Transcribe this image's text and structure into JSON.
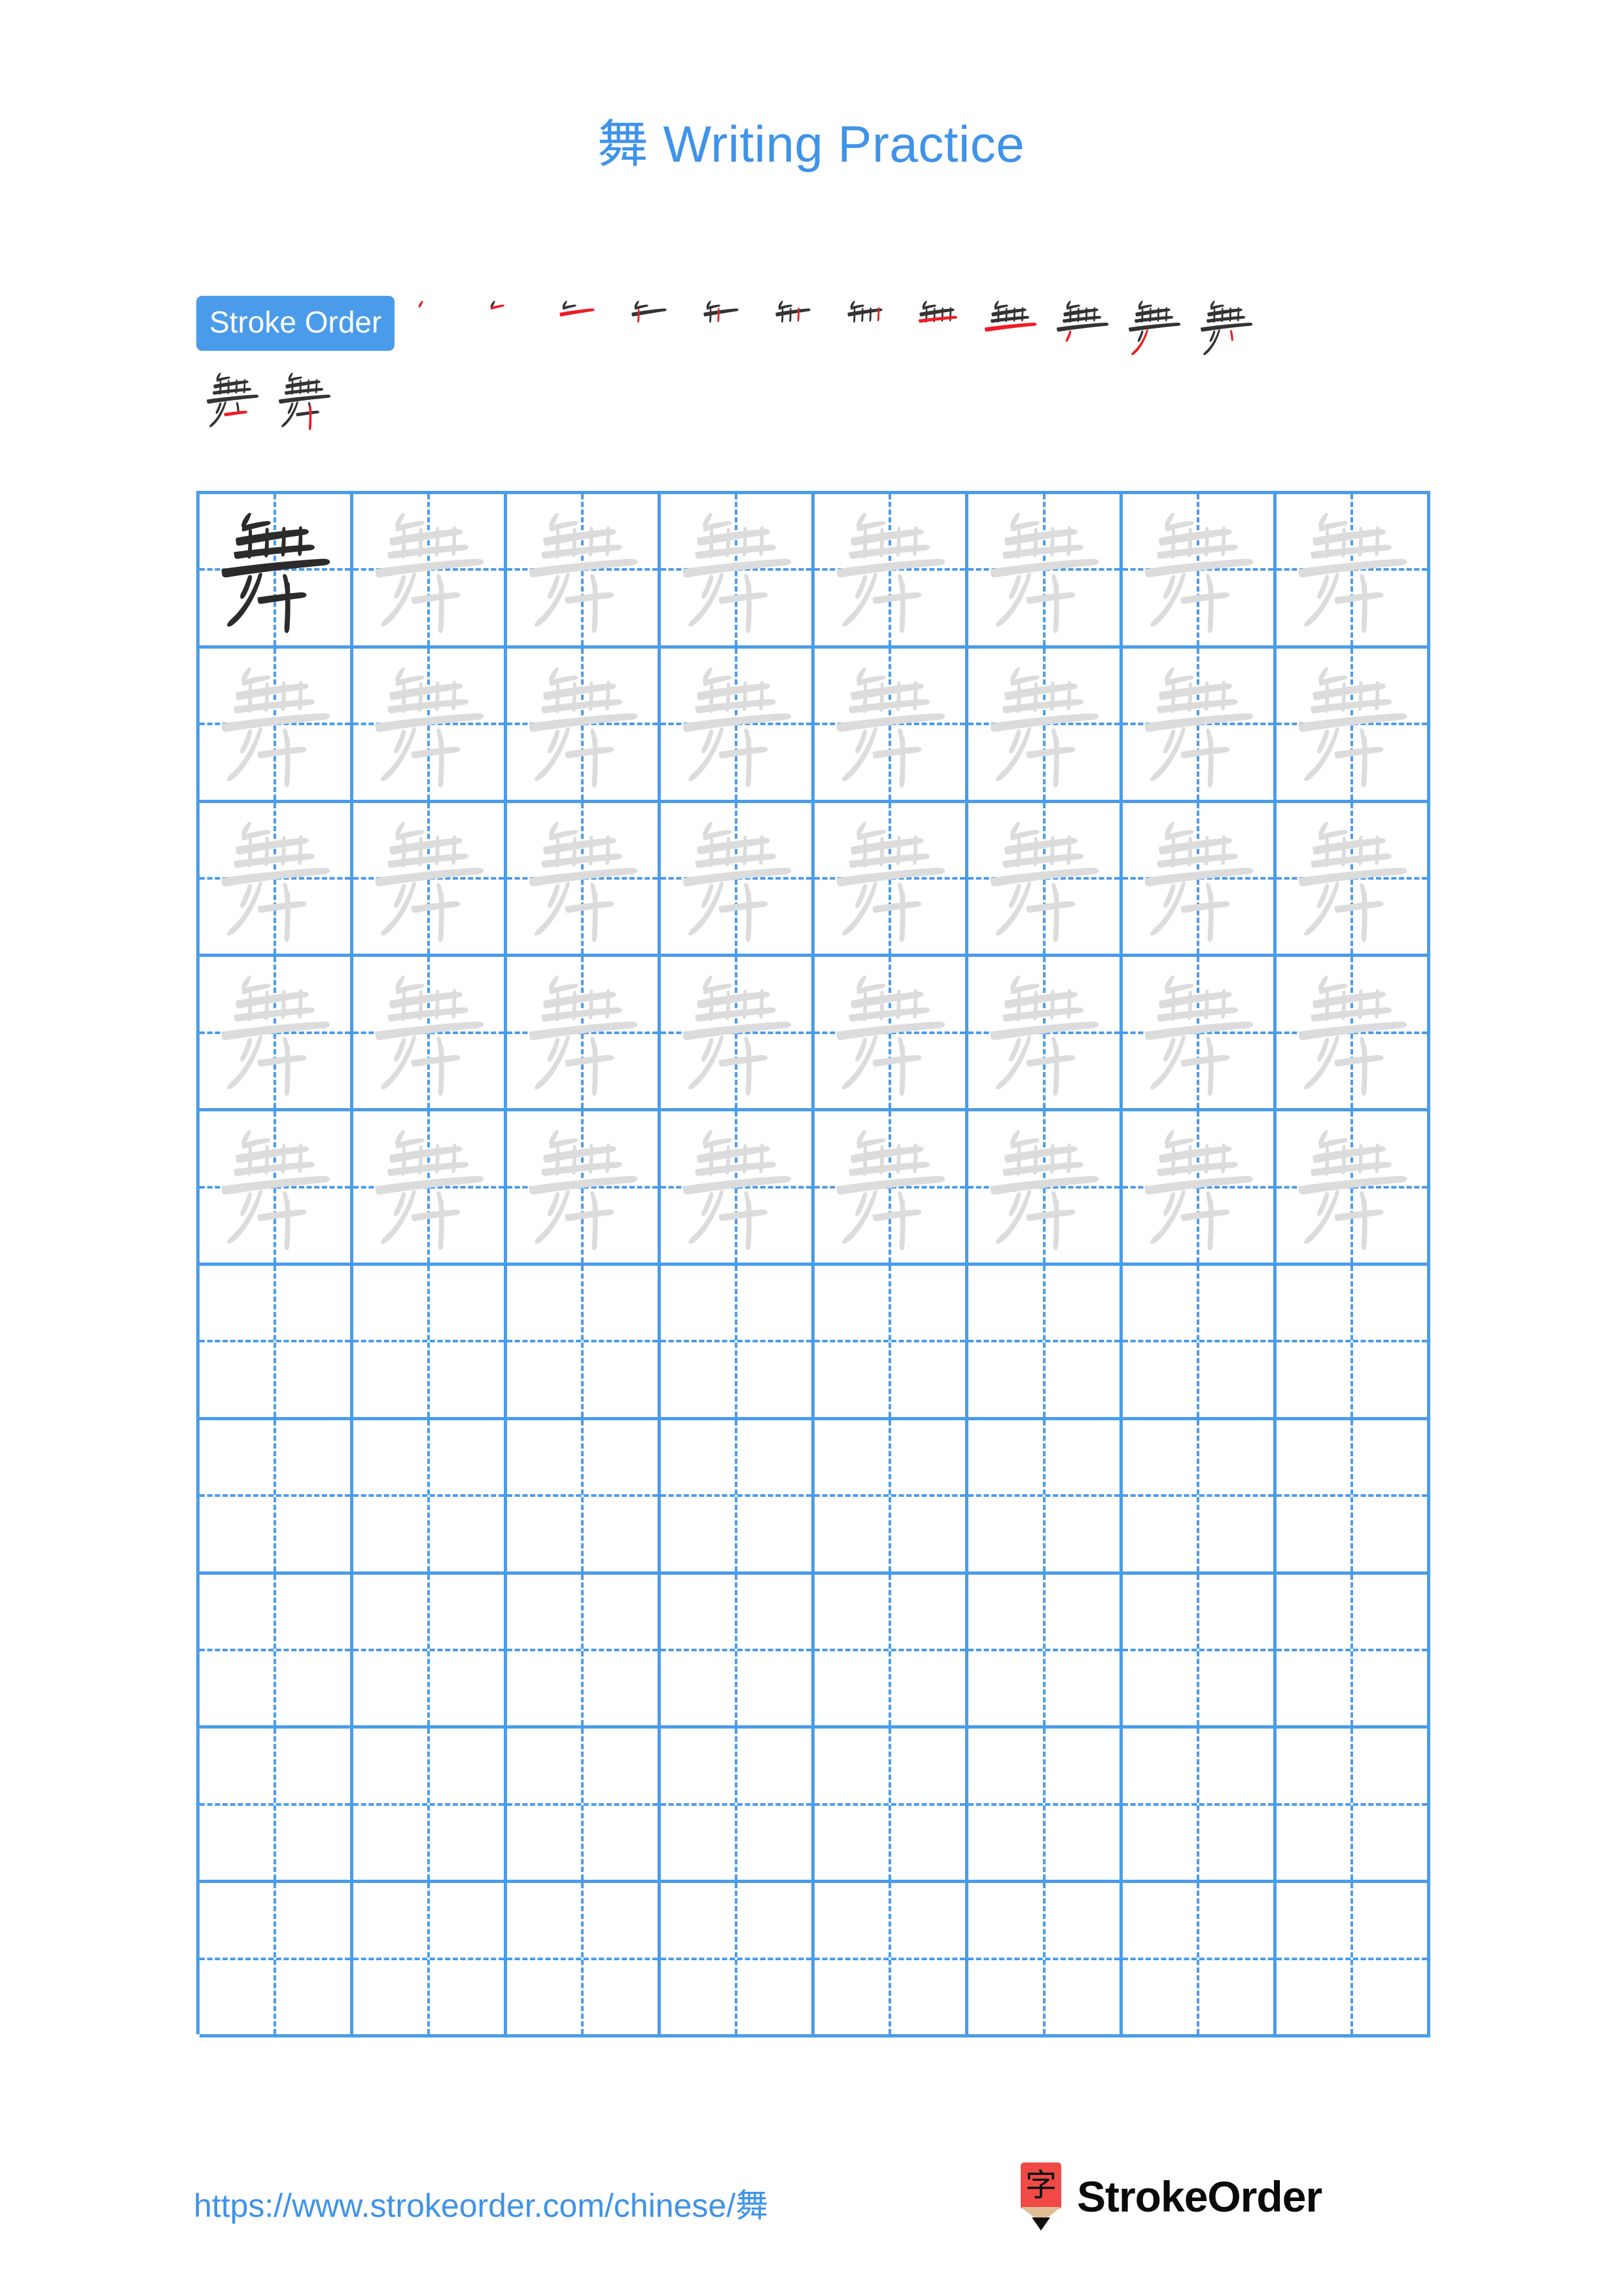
{
  "character": "舞",
  "title": "舞 Writing Practice",
  "colors": {
    "accent_blue": "#3f93e8",
    "badge_blue": "#4a9ceb",
    "grid_blue": "#4a9ceb",
    "stroke_new_red": "#ee1c25",
    "stroke_done_dark": "#333333",
    "trace_gray": "#dcdcdc",
    "logo_red": "#ef4a45",
    "logo_wood": "#e0bd95"
  },
  "stroke_order": {
    "badge_label": "Stroke Order",
    "total_strokes": 14,
    "row1_count": 12,
    "row2_count": 2,
    "steps": [
      {
        "index": 1,
        "strokes_shown": 1
      },
      {
        "index": 2,
        "strokes_shown": 2
      },
      {
        "index": 3,
        "strokes_shown": 3
      },
      {
        "index": 4,
        "strokes_shown": 4
      },
      {
        "index": 5,
        "strokes_shown": 5
      },
      {
        "index": 6,
        "strokes_shown": 6
      },
      {
        "index": 7,
        "strokes_shown": 7
      },
      {
        "index": 8,
        "strokes_shown": 8
      },
      {
        "index": 9,
        "strokes_shown": 9
      },
      {
        "index": 10,
        "strokes_shown": 10
      },
      {
        "index": 11,
        "strokes_shown": 11
      },
      {
        "index": 12,
        "strokes_shown": 12
      },
      {
        "index": 13,
        "strokes_shown": 13
      },
      {
        "index": 14,
        "strokes_shown": 14
      }
    ]
  },
  "grid": {
    "columns": 8,
    "rows": 10,
    "filled_rows": 5,
    "empty_rows": 5,
    "first_cell_style": "dark",
    "trace_cell_style": "light-gray",
    "guide_lines": "dashed-cross"
  },
  "footer": {
    "url": "https://www.strokeorder.com/chinese/舞",
    "logo_character": "字",
    "logo_text": "StrokeOrder"
  }
}
